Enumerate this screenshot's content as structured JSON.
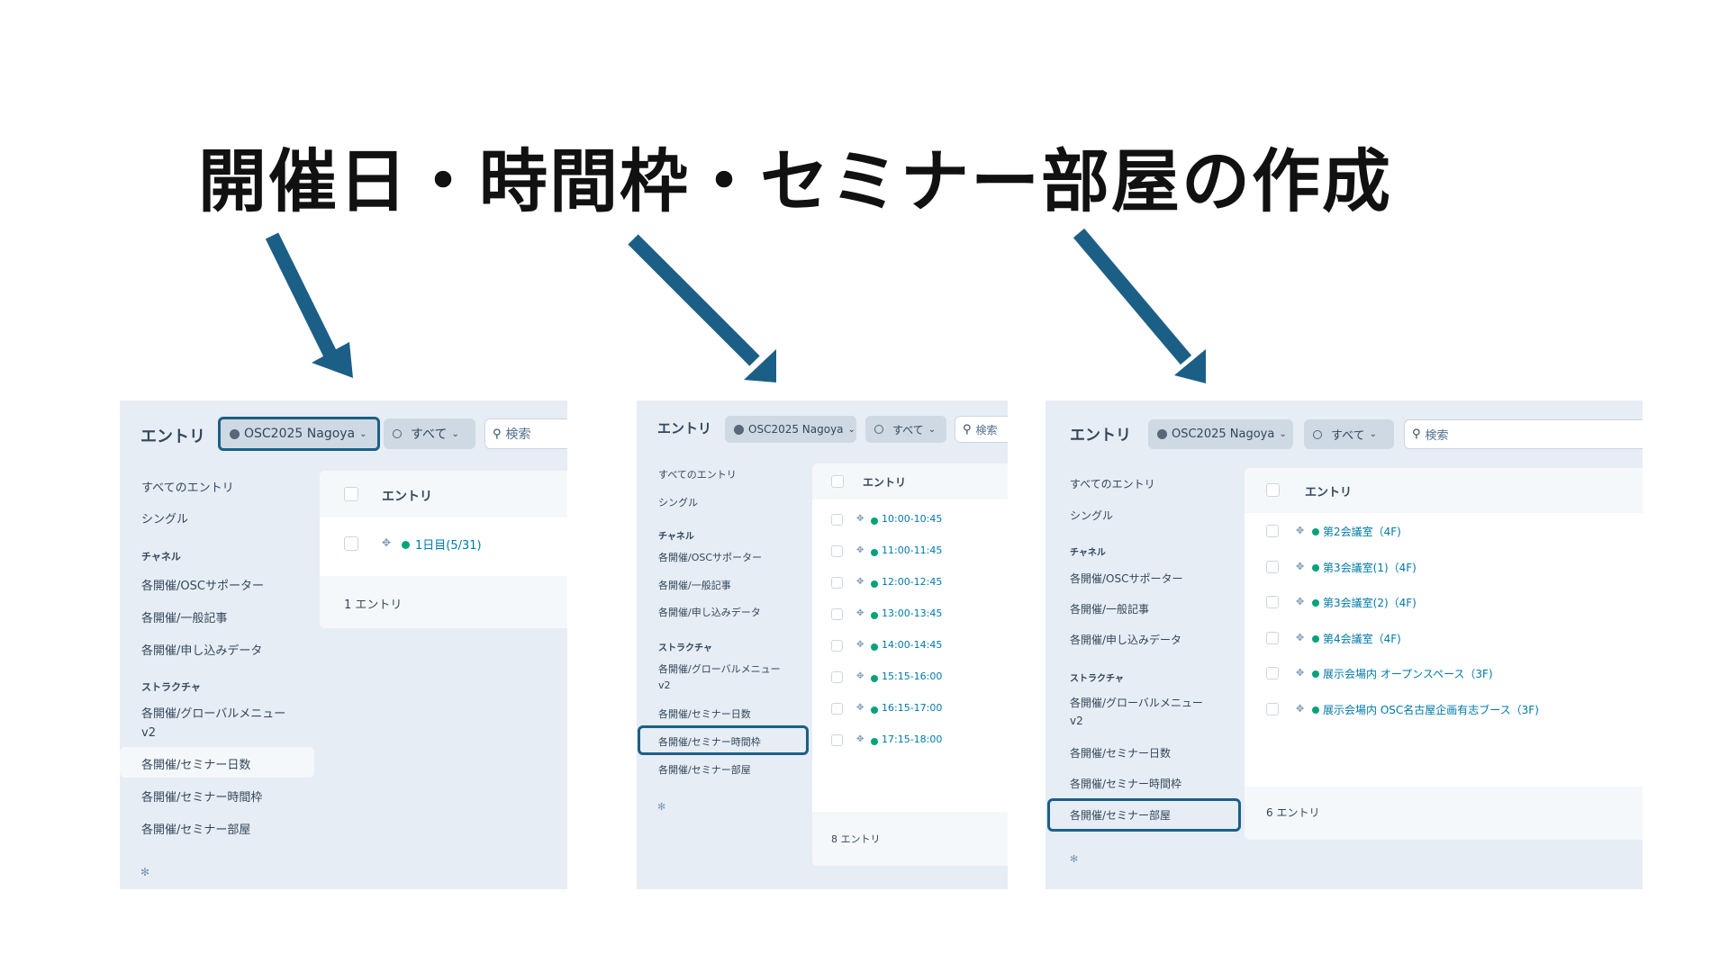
{
  "heading": "開催日・時間枠・セミナー部屋の作成",
  "colors": {
    "accent": "#1c5f86",
    "published_dot": "#00a37a",
    "link": "#0079a8",
    "panel_bg": "#e6edf5"
  },
  "panels": [
    {
      "title": "エントリ",
      "site_select": "OSC2025 Nagoya",
      "status_select": "すべて",
      "search_placeholder": "検索",
      "nav": {
        "all": "すべてのエントリ",
        "single": "シングル",
        "channel_header": "チャネル",
        "channels": [
          "各開催/OSCサポーター",
          "各開催/一般記事",
          "各開催/申し込みデータ"
        ],
        "structure_header": "ストラクチャ",
        "structures": [
          "各開催/グローバルメニュー\nv2",
          "各開催/セミナー日数",
          "各開催/セミナー時間枠",
          "各開催/セミナー部屋"
        ],
        "active": "各開催/セミナー日数"
      },
      "table_header": "エントリ",
      "rows": [
        "1日目(5/31)"
      ],
      "count": "1 エントリ"
    },
    {
      "title": "エントリ",
      "site_select": "OSC2025 Nagoya",
      "status_select": "すべて",
      "search_placeholder": "検索",
      "nav": {
        "all": "すべてのエントリ",
        "single": "シングル",
        "channel_header": "チャネル",
        "channels": [
          "各開催/OSCサポーター",
          "各開催/一般記事",
          "各開催/申し込みデータ"
        ],
        "structure_header": "ストラクチャ",
        "structures": [
          "各開催/グローバルメニュー\nv2",
          "各開催/セミナー日数",
          "各開催/セミナー時間枠",
          "各開催/セミナー部屋"
        ],
        "active": "各開催/セミナー時間枠"
      },
      "table_header": "エントリ",
      "rows": [
        "10:00-10:45",
        "11:00-11:45",
        "12:00-12:45",
        "13:00-13:45",
        "14:00-14:45",
        "15:15-16:00",
        "16:15-17:00",
        "17:15-18:00"
      ],
      "count": "8 エントリ"
    },
    {
      "title": "エントリ",
      "site_select": "OSC2025 Nagoya",
      "status_select": "すべて",
      "search_placeholder": "検索",
      "nav": {
        "all": "すべてのエントリ",
        "single": "シングル",
        "channel_header": "チャネル",
        "channels": [
          "各開催/OSCサポーター",
          "各開催/一般記事",
          "各開催/申し込みデータ"
        ],
        "structure_header": "ストラクチャ",
        "structures": [
          "各開催/グローバルメニュー\nv2",
          "各開催/セミナー日数",
          "各開催/セミナー時間枠",
          "各開催/セミナー部屋"
        ],
        "active": "各開催/セミナー部屋"
      },
      "table_header": "エントリ",
      "rows": [
        "第2会議室（4F)",
        "第3会議室(1)（4F)",
        "第3会議室(2)（4F)",
        "第4会議室（4F)",
        "展示会場内 オープンスペース（3F)",
        "展示会場内 OSC名古屋企画有志ブース（3F)"
      ],
      "count": "6 エントリ"
    }
  ]
}
